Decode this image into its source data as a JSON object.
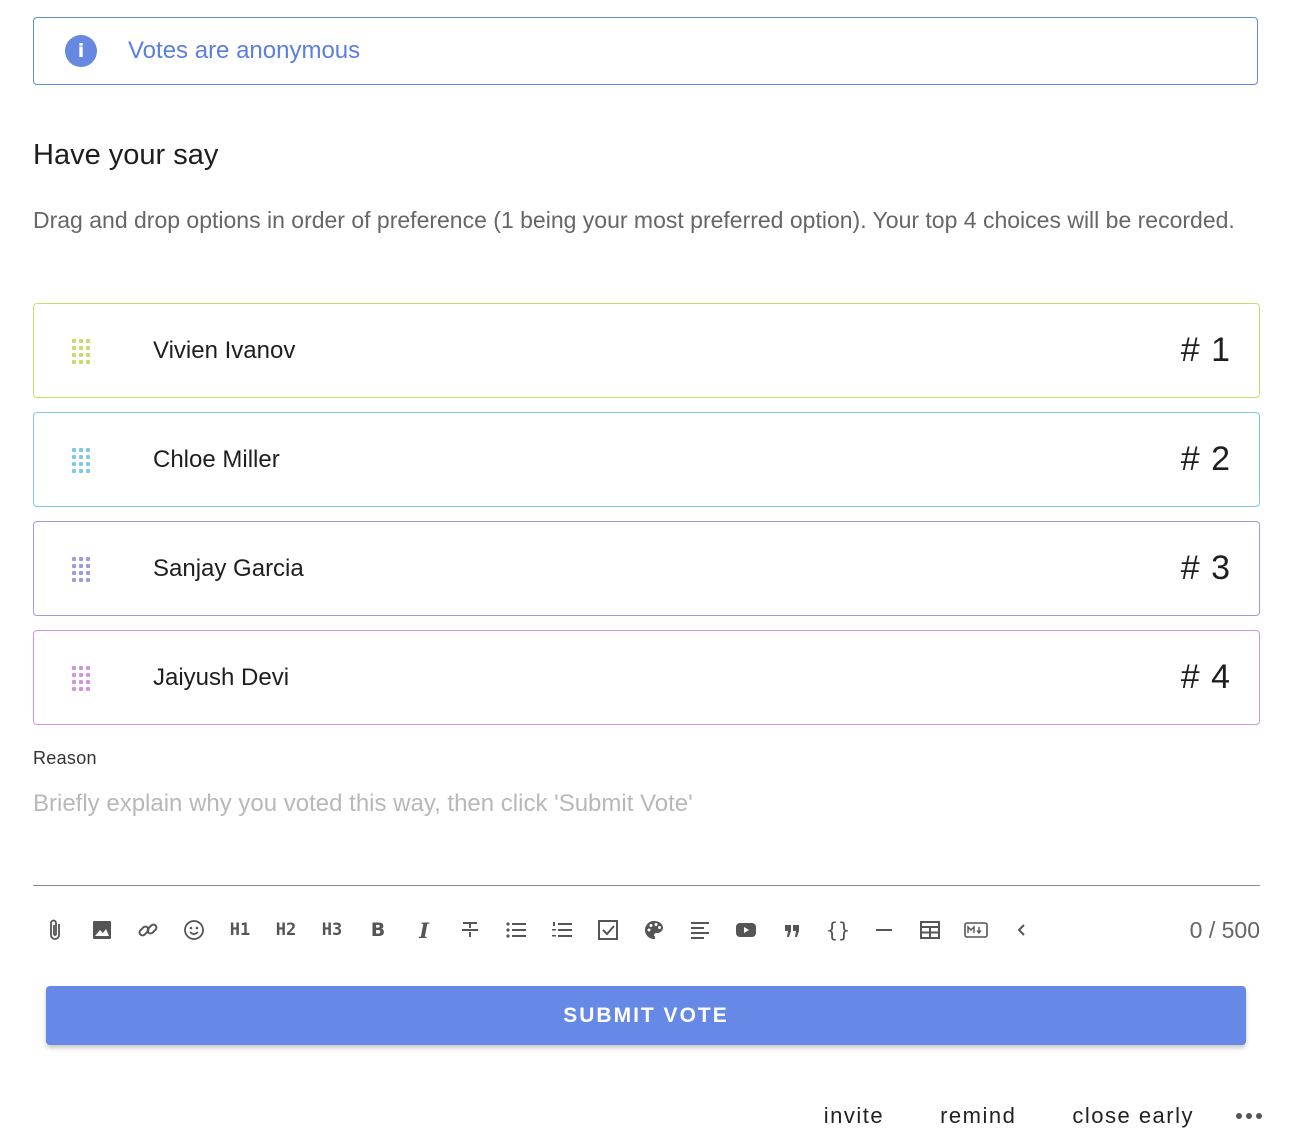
{
  "banner": {
    "icon": "info-icon",
    "icon_glyph": "i",
    "text": "Votes are anonymous",
    "color": "#6688e0"
  },
  "vote": {
    "title": "Have your say",
    "instructions": "Drag and drop options in order of preference (1 being your most preferred option). Your top 4 choices will be recorded.",
    "options": [
      {
        "name": "Vivien Ivanov",
        "rank": "# 1",
        "color": "#c8dc6a"
      },
      {
        "name": "Chloe Miller",
        "rank": "# 2",
        "color": "#7ec8e8"
      },
      {
        "name": "Sanjay Garcia",
        "rank": "# 3",
        "color": "#9b9be0"
      },
      {
        "name": "Jaiyush Devi",
        "rank": "# 4",
        "color": "#d294dc"
      }
    ]
  },
  "reason": {
    "label": "Reason",
    "placeholder": "Briefly explain why you voted this way, then click 'Submit Vote'",
    "value": ""
  },
  "toolbar": {
    "items": [
      {
        "name": "attach-icon",
        "label": ""
      },
      {
        "name": "image-icon",
        "label": ""
      },
      {
        "name": "link-icon",
        "label": ""
      },
      {
        "name": "emoji-icon",
        "label": ""
      },
      {
        "name": "heading-1-button",
        "label": "H1"
      },
      {
        "name": "heading-2-button",
        "label": "H2"
      },
      {
        "name": "heading-3-button",
        "label": "H3"
      },
      {
        "name": "bold-button",
        "label": "B"
      },
      {
        "name": "italic-button",
        "label": "I"
      },
      {
        "name": "strikethrough-icon",
        "label": ""
      },
      {
        "name": "bullet-list-icon",
        "label": ""
      },
      {
        "name": "numbered-list-icon",
        "label": ""
      },
      {
        "name": "checkbox-list-icon",
        "label": ""
      },
      {
        "name": "palette-icon",
        "label": ""
      },
      {
        "name": "align-icon",
        "label": ""
      },
      {
        "name": "video-icon",
        "label": ""
      },
      {
        "name": "quote-icon",
        "label": ""
      },
      {
        "name": "code-icon",
        "label": "{}"
      },
      {
        "name": "horizontal-rule-icon",
        "label": ""
      },
      {
        "name": "table-icon",
        "label": ""
      },
      {
        "name": "markdown-icon",
        "label": ""
      },
      {
        "name": "collapse-icon",
        "label": ""
      }
    ],
    "char_count": "0 / 500"
  },
  "submit": {
    "label": "SUBMIT VOTE",
    "color": "#6688e6"
  },
  "footer": {
    "invite": "invite",
    "remind": "remind",
    "close_early": "close early",
    "more_icon": "more-horizontal-icon"
  }
}
